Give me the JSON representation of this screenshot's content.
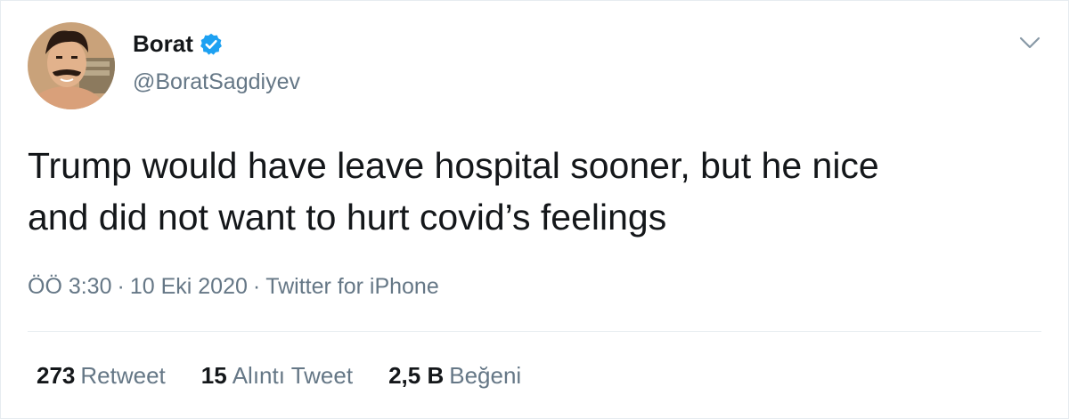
{
  "user": {
    "display_name": "Borat",
    "handle": "@BoratSagdiyev",
    "verified": true
  },
  "tweet": {
    "text_line1": "Trump would have leave hospital sooner, but he nice",
    "text_line2": "and did not want to hurt covid’s feelings"
  },
  "meta": {
    "time": "ÖÖ 3:30",
    "separator": "·",
    "date": "10 Eki 2020",
    "source": "Twitter for iPhone"
  },
  "stats": [
    {
      "count": "273",
      "label": "Retweet"
    },
    {
      "count": "15",
      "label": "Alıntı Tweet"
    },
    {
      "count": "2,5 B",
      "label": "Beğeni"
    }
  ],
  "icons": {
    "verified": "verified-badge-icon",
    "menu": "chevron-down-icon"
  },
  "colors": {
    "text": "#14171a",
    "secondary": "#657786",
    "verified": "#1da1f2",
    "divider": "#e6ecf0"
  }
}
